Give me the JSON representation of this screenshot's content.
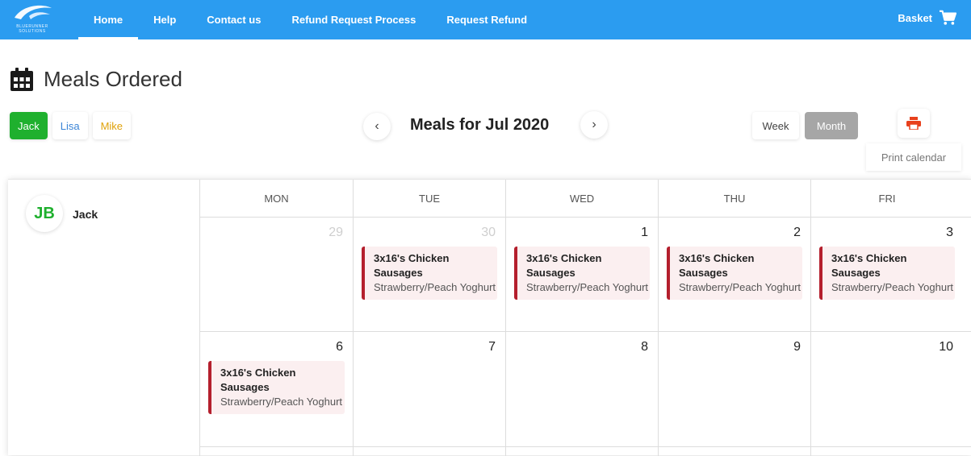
{
  "brand": {
    "logo_text": "BLUERUNNER SOLUTIONS"
  },
  "nav": {
    "items": [
      {
        "label": "Home"
      },
      {
        "label": "Help"
      },
      {
        "label": "Contact us"
      },
      {
        "label": "Refund Request Process"
      },
      {
        "label": "Request Refund"
      }
    ],
    "basket_label": "Basket"
  },
  "page": {
    "title": "Meals Ordered"
  },
  "people": [
    {
      "label": "Jack"
    },
    {
      "label": "Lisa"
    },
    {
      "label": "Mike"
    }
  ],
  "calendar": {
    "title": "Meals for Jul 2020",
    "prev": "‹",
    "next": "›",
    "view_week": "Week",
    "view_month": "Month",
    "print_label": "Print calendar",
    "person": {
      "initials": "JB",
      "name": "Jack"
    },
    "days_of_week": [
      "MON",
      "TUE",
      "WED",
      "THU",
      "FRI"
    ],
    "weeks": [
      [
        {
          "day": "29",
          "muted": true
        },
        {
          "day": "30",
          "muted": true,
          "meal": {
            "title": "3x16's Chicken Sausages",
            "sub": "Strawberry/Peach Yoghurt"
          }
        },
        {
          "day": "1",
          "meal": {
            "title": "3x16's Chicken Sausages",
            "sub": "Strawberry/Peach Yoghurt"
          }
        },
        {
          "day": "2",
          "meal": {
            "title": "3x16's Chicken Sausages",
            "sub": "Strawberry/Peach Yoghurt"
          }
        },
        {
          "day": "3",
          "meal": {
            "title": "3x16's Chicken Sausages",
            "sub": "Strawberry/Peach Yoghurt"
          }
        }
      ],
      [
        {
          "day": "6",
          "meal": {
            "title": "3x16's Chicken Sausages",
            "sub": "Strawberry/Peach Yoghurt"
          }
        },
        {
          "day": "7"
        },
        {
          "day": "8"
        },
        {
          "day": "9"
        },
        {
          "day": "10"
        }
      ]
    ]
  },
  "colors": {
    "topbar": "#2b9cf0",
    "jack": "#1fb02e",
    "lisa": "#3a84d6",
    "mike": "#e0a20a",
    "meal_accent": "#b41f2d",
    "print_icon": "#e8401c"
  }
}
